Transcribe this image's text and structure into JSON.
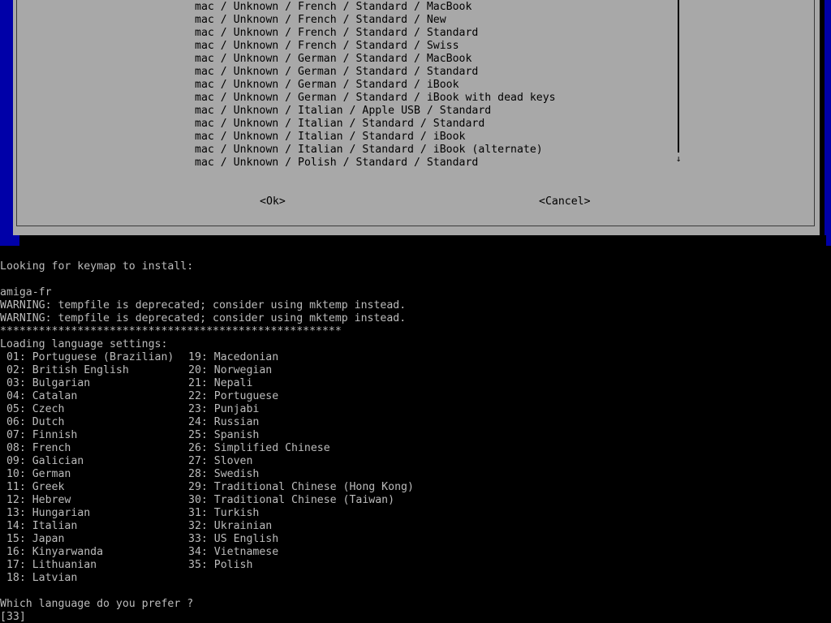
{
  "dialog": {
    "keymaps": [
      "mac / Unknown / French / Standard / MacBook",
      "mac / Unknown / French / Standard / New",
      "mac / Unknown / French / Standard / Standard",
      "mac / Unknown / French / Standard / Swiss",
      "mac / Unknown / German / Standard / MacBook",
      "mac / Unknown / German / Standard / Standard",
      "mac / Unknown / German / Standard / iBook",
      "mac / Unknown / German / Standard / iBook with dead keys",
      "mac / Unknown / Italian / Apple USB / Standard",
      "mac / Unknown / Italian / Standard / Standard",
      "mac / Unknown / Italian / Standard / iBook",
      "mac / Unknown / Italian / Standard / iBook (alternate)",
      "mac / Unknown / Polish / Standard / Standard"
    ],
    "scroll_down_glyph": "↓",
    "ok_label": "<Ok>",
    "cancel_label": "<Cancel>"
  },
  "console": {
    "looking_line": "Looking for keymap to install:",
    "keymap_name": "amiga-fr",
    "warning_1": "WARNING: tempfile is deprecated; consider using mktemp instead.",
    "warning_2": "WARNING: tempfile is deprecated; consider using mktemp instead.",
    "separator": "*****************************************************",
    "loading_line": "Loading language settings:",
    "languages_left": [
      " 01: Portuguese (Brazilian)",
      " 02: British English",
      " 03: Bulgarian",
      " 04: Catalan",
      " 05: Czech",
      " 06: Dutch",
      " 07: Finnish",
      " 08: French",
      " 09: Galician",
      " 10: German",
      " 11: Greek",
      " 12: Hebrew",
      " 13: Hungarian",
      " 14: Italian",
      " 15: Japan",
      " 16: Kinyarwanda",
      " 17: Lithuanian",
      " 18: Latvian"
    ],
    "languages_right": [
      "19: Macedonian",
      "20: Norwegian",
      "21: Nepali",
      "22: Portuguese",
      "23: Punjabi",
      "24: Russian",
      "25: Spanish",
      "26: Simplified Chinese",
      "27: Sloven",
      "28: Swedish",
      "29: Traditional Chinese (Hong Kong)",
      "30: Traditional Chinese (Taiwan)",
      "31: Turkish",
      "32: Ukrainian",
      "33: US English",
      "34: Vietnamese",
      "35: Polish"
    ],
    "prompt": "Which language do you prefer ?",
    "answer": "[33]"
  },
  "colors": {
    "console_bg": "#000000",
    "console_text": "#bcbcbc",
    "dialog_bg": "#a8a8a8",
    "backdrop_blue": "#0000a8",
    "dialog_text": "#000000"
  }
}
